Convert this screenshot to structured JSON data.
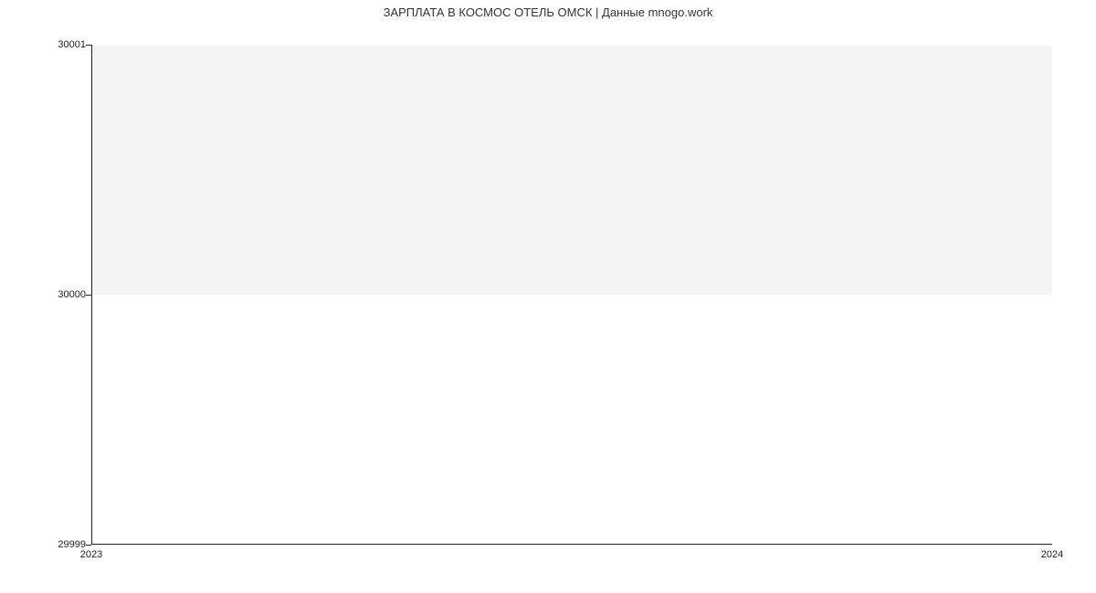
{
  "chart_data": {
    "type": "line",
    "title": "ЗАРПЛАТА В КОСМОС ОТЕЛЬ ОМСК | Данные mnogo.work",
    "xlabel": "",
    "ylabel": "",
    "x": [
      "2023",
      "2024"
    ],
    "values": [
      30000,
      30000
    ],
    "ylim": [
      29999,
      30001
    ],
    "yticks": [
      29999,
      30000,
      30001
    ],
    "xticks": [
      "2023",
      "2024"
    ],
    "series_color": "#3b82e0"
  }
}
